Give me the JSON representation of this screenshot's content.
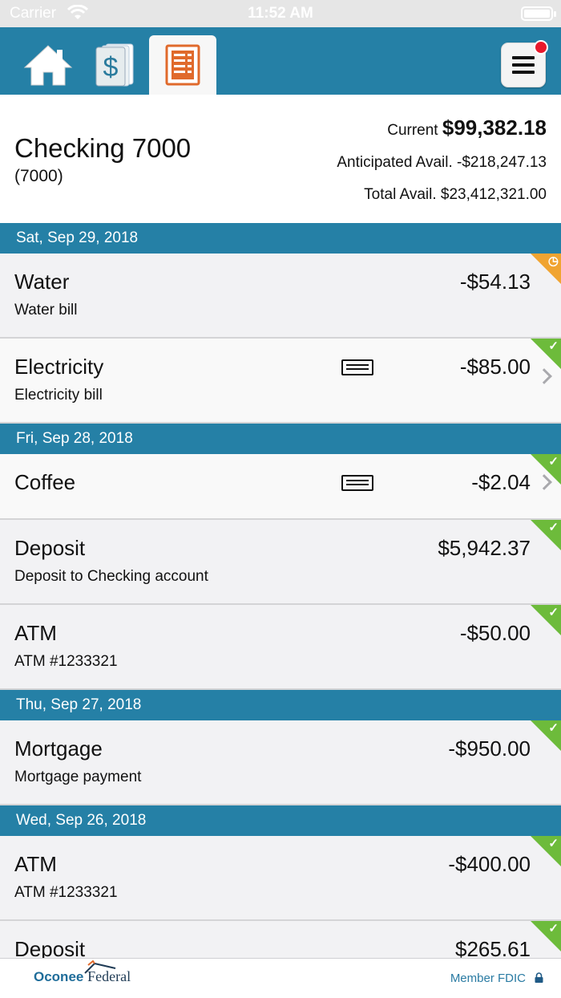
{
  "status_bar": {
    "carrier": "Carrier",
    "time": "11:52 AM"
  },
  "nav": {
    "tabs": [
      {
        "name": "home-icon"
      },
      {
        "name": "dollar-cards-icon"
      },
      {
        "name": "register-list-icon",
        "active": true
      }
    ],
    "menu": {
      "icon": "hamburger-icon",
      "badge": true
    }
  },
  "account": {
    "name": "Checking 7000",
    "number": "(7000)",
    "current_label": "Current",
    "current_amount": "$99,382.18",
    "anticipated": "Anticipated Avail. -$218,247.13",
    "total": "Total Avail. $23,412,321.00"
  },
  "groups": [
    {
      "date": "Sat, Sep 29, 2018",
      "transactions": [
        {
          "title": "Water",
          "amount": "-$54.13",
          "desc": "Water bill",
          "status": "pending"
        },
        {
          "title": "Electricity",
          "amount": "-$85.00",
          "desc": "Electricity bill",
          "status": "cleared",
          "card": true,
          "chevron": true
        }
      ]
    },
    {
      "date": "Fri, Sep 28, 2018",
      "transactions": [
        {
          "title": "Coffee",
          "amount": "-$2.04",
          "desc": "",
          "status": "cleared",
          "card": true,
          "chevron": true
        },
        {
          "title": "Deposit",
          "amount": "$5,942.37",
          "desc": "Deposit to Checking account",
          "status": "cleared"
        },
        {
          "title": "ATM",
          "amount": "-$50.00",
          "desc": "ATM #1233321",
          "status": "cleared"
        }
      ]
    },
    {
      "date": "Thu, Sep 27, 2018",
      "transactions": [
        {
          "title": "Mortgage",
          "amount": "-$950.00",
          "desc": "Mortgage payment",
          "status": "cleared"
        }
      ]
    },
    {
      "date": "Wed, Sep 26, 2018",
      "transactions": [
        {
          "title": "ATM",
          "amount": "-$400.00",
          "desc": "ATM #1233321",
          "status": "cleared"
        },
        {
          "title": "Deposit",
          "amount": "$265.61",
          "desc": "",
          "status": "cleared"
        }
      ]
    }
  ],
  "footer": {
    "logo_part1": "Oconee",
    "logo_part2": "Federal",
    "fdic": "Member FDIC"
  },
  "colors": {
    "header_blue": "#2580a6",
    "cleared": "#6dbb3b",
    "pending": "#f0a431",
    "register_orange": "#e06a2c"
  }
}
